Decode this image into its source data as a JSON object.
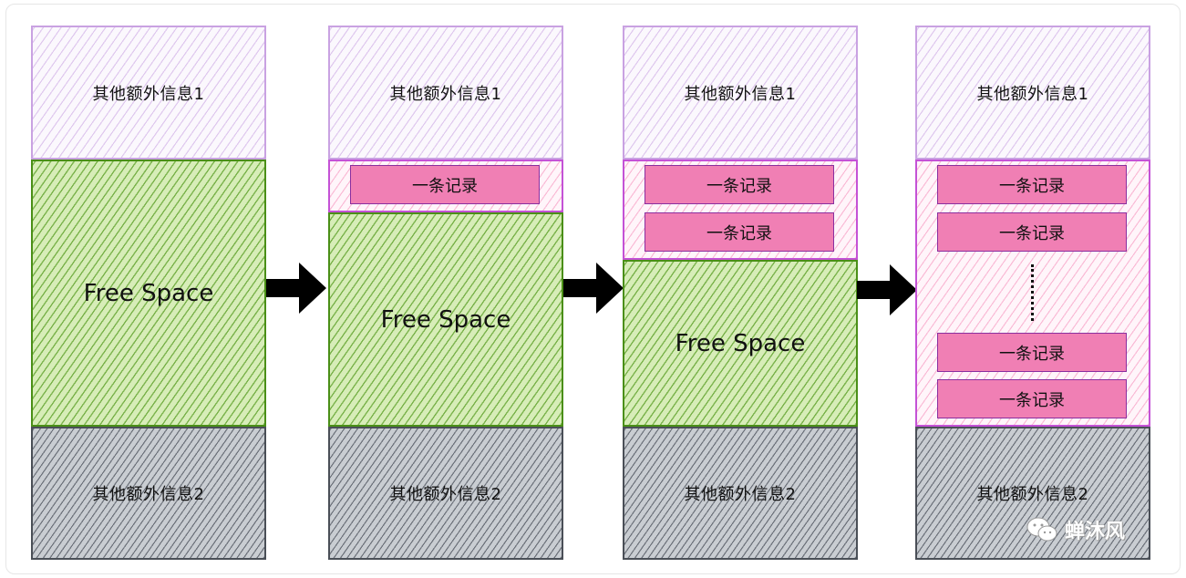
{
  "labels": {
    "info1": "其他额外信息1",
    "info2": "其他额外信息2",
    "free_space": "Free Space",
    "record": "一条记录"
  },
  "watermark": {
    "text": "蝉沐风",
    "icon": "wechat-icon"
  },
  "colors": {
    "info1_border": "#c9a2e2",
    "free_space_border": "#4a8f17",
    "info2_border": "#4a4f57",
    "record_fill": "#f07fb4",
    "record_area_border": "#c452d6",
    "arrow": "#000000"
  }
}
